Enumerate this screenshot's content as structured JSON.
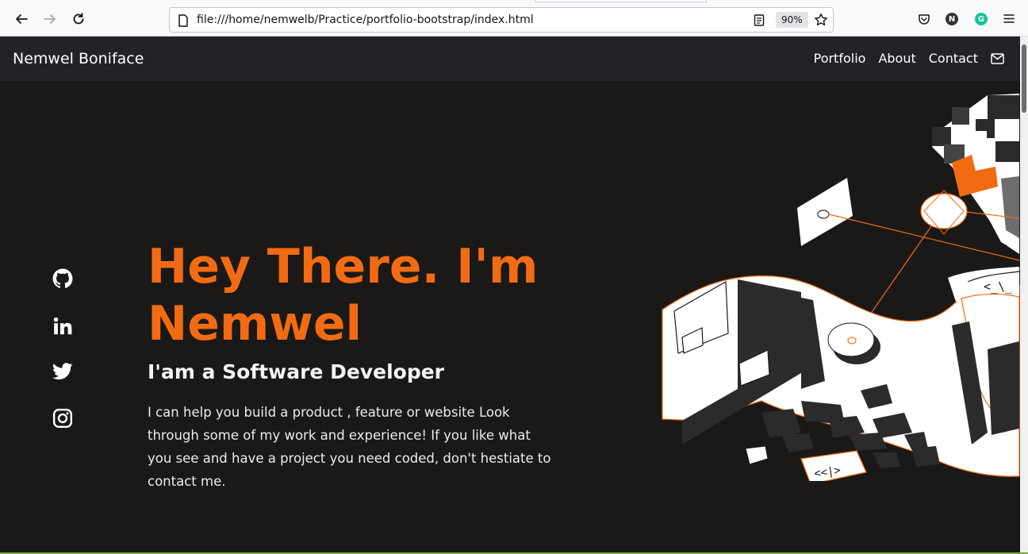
{
  "browser": {
    "url": "file:///home/nemwelb/Practice/portfolio-bootstrap/index.html",
    "zoom": "90%",
    "profile_initial": "N",
    "extension_initial": "G"
  },
  "navbar": {
    "brand": "Nemwel Boniface",
    "links": [
      {
        "label": "Portfolio"
      },
      {
        "label": "About"
      },
      {
        "label": "Contact"
      }
    ]
  },
  "hero": {
    "title": "Hey There. I'm Nemwel",
    "subtitle": "I'am a Software Developer",
    "description": "I can help you build a product , feature or website Look through some of my work and experience! If you like what you see and have a project you need coded, don't hestiate to contact me.",
    "social_icons": [
      "github-icon",
      "linkedin-icon",
      "twitter-icon",
      "instagram-icon"
    ],
    "illustration_code_tags": [
      "<_\\_",
      "<<|>"
    ]
  },
  "colors": {
    "accent": "#f26b12",
    "background": "#1a1918",
    "navbar": "#212327"
  }
}
